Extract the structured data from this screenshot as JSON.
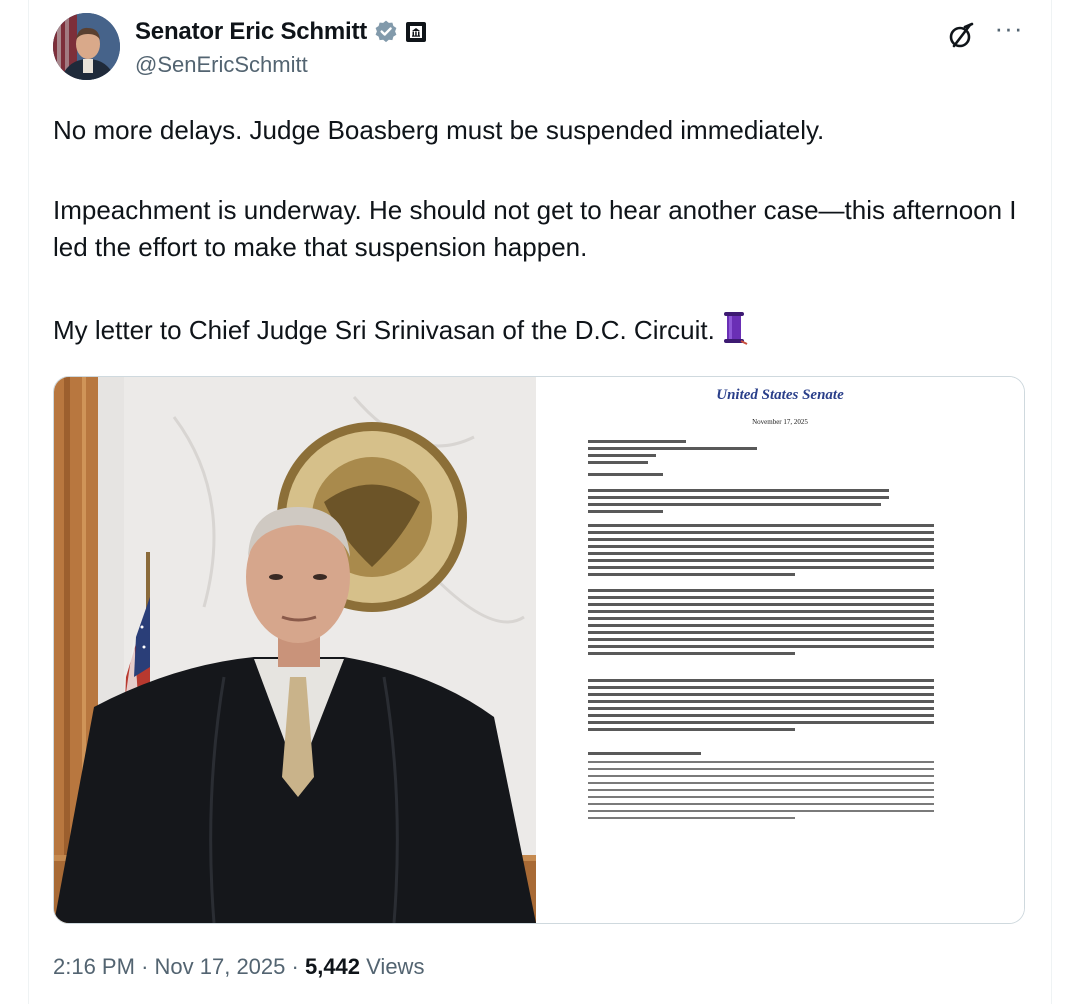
{
  "post": {
    "author": {
      "display_name": "Senator Eric Schmitt",
      "handle": "@SenEricSchmitt",
      "verified_icon": "verified-badge-icon",
      "affiliation_icon": "government-badge-icon"
    },
    "actions": {
      "grok_icon": "grok-icon",
      "more_label": "···"
    },
    "text": {
      "paragraph1": "No more delays. Judge Boasberg must be suspended immediately.",
      "paragraph2": "Impeachment is underway. He should not get to hear another case—this afternoon I led the effort to make that suspension happen.",
      "paragraph3": "My letter to Chief Judge Sri Srinivasan of the D.C. Circuit.",
      "emoji": "scroll-emoji"
    },
    "media": {
      "letter": {
        "letterhead": "United States Senate",
        "date": "November 17, 2025"
      }
    },
    "footer": {
      "time": "2:16 PM",
      "separator": "·",
      "date": "Nov 17, 2025",
      "views_count": "5,442",
      "views_label": "Views"
    }
  },
  "colors": {
    "text_primary": "#0f1419",
    "text_secondary": "#536471",
    "verified": "#829aab",
    "border": "#cfd9de",
    "letterhead": "#2a3f8a"
  }
}
